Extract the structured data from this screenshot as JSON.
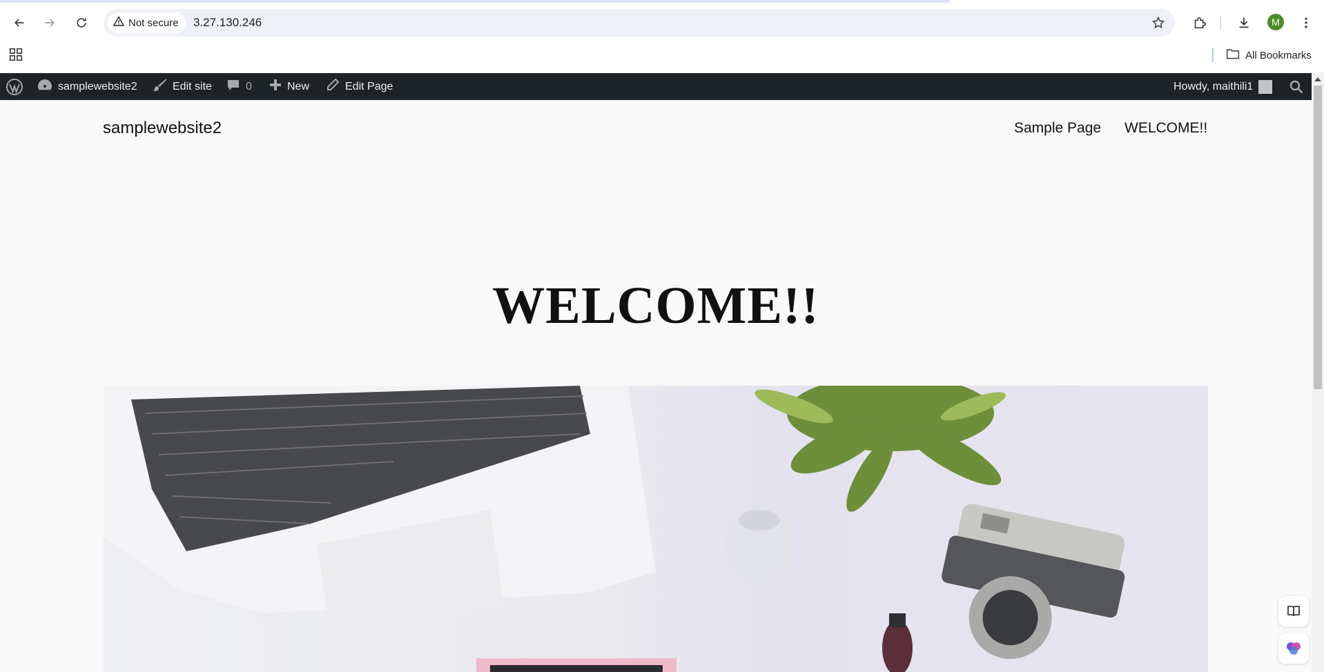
{
  "browser": {
    "security_label": "Not secure",
    "url": "3.27.130.246",
    "avatar_letter": "M",
    "bookmarks_label": "All Bookmarks"
  },
  "adminbar": {
    "site_name": "samplewebsite2",
    "edit_site": "Edit site",
    "comments_count": "0",
    "new_label": "New",
    "edit_page": "Edit Page",
    "howdy": "Howdy, maithili1"
  },
  "site": {
    "title": "samplewebsite2",
    "nav": [
      "Sample Page",
      "WELCOME!!"
    ],
    "heading": "WELCOME!!"
  },
  "colors": {
    "adminbar_bg": "#1d2327",
    "page_bg": "#f9f9f9",
    "avatar_bg": "#4a8f2b"
  }
}
